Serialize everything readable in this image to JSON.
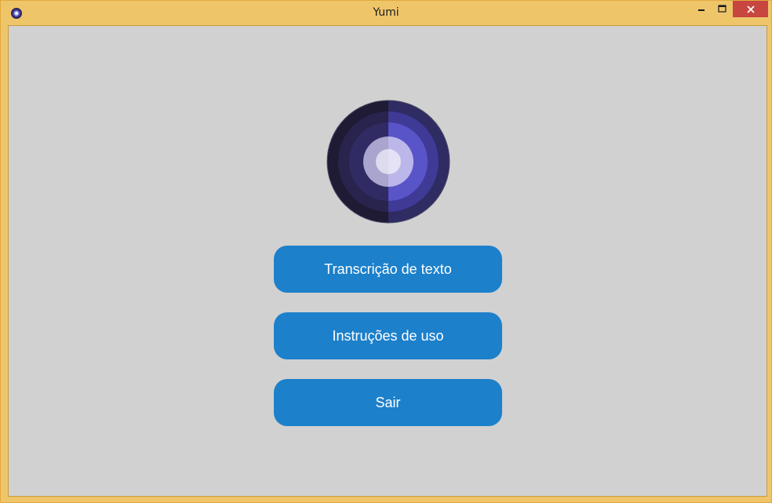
{
  "window": {
    "title": "Yumi",
    "app_icon": "yumi-app-icon",
    "controls": {
      "minimize_icon": "minimize-icon",
      "maximize_icon": "maximize-icon",
      "close_icon": "close-icon"
    }
  },
  "logo": {
    "icon": "yumi-logo-icon",
    "colors": [
      "#1f1b35",
      "#2f2b63",
      "#3a3580",
      "#4d47b0",
      "#5e58cf",
      "#b9b4e8",
      "#e4e2f4"
    ]
  },
  "menu": {
    "buttons": [
      {
        "label": "Transcrição de texto"
      },
      {
        "label": "Instruções de uso"
      },
      {
        "label": "Sair"
      }
    ]
  },
  "colors": {
    "titlebar": "#efc56a",
    "close_button": "#c7463f",
    "content_bg": "#d1d1d1",
    "button_bg": "#1c80cb",
    "button_text": "#ffffff"
  }
}
